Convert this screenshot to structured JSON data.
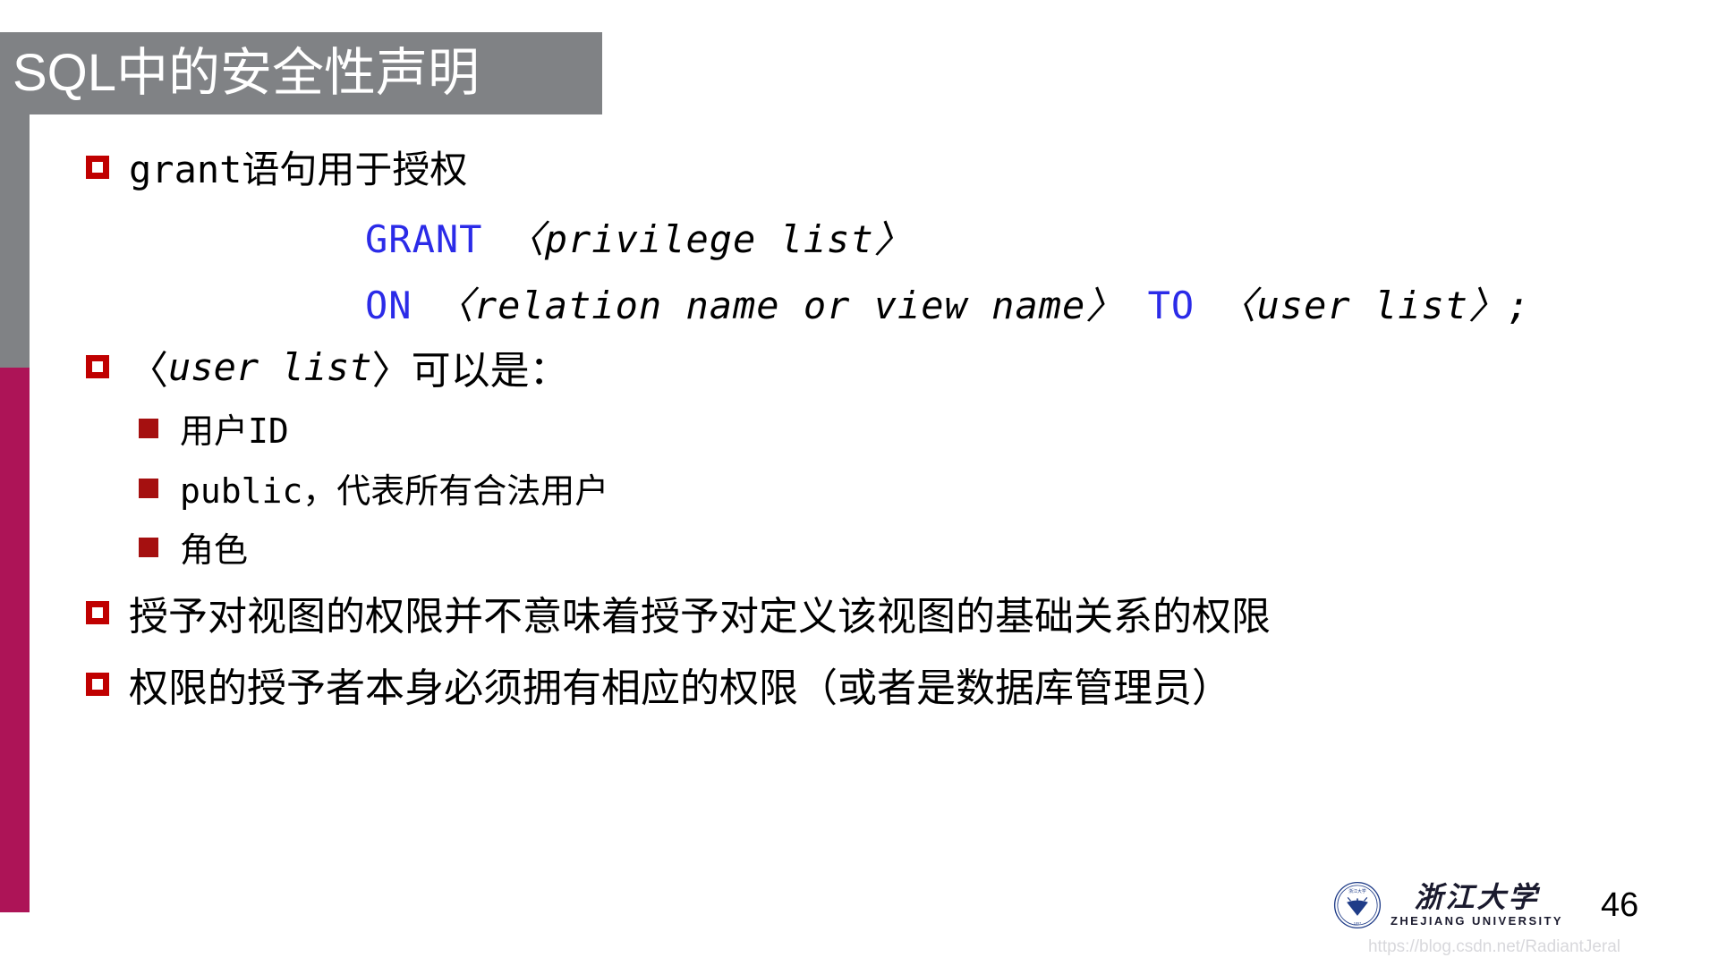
{
  "slide": {
    "title": "SQL中的安全性声明",
    "colors": {
      "banner": "#808285",
      "left_strip_top": "#808285",
      "left_strip_bottom": "#AD1457",
      "bullet_level1": "#C00000",
      "bullet_level2": "#A51010",
      "keyword": "#2B2BE8",
      "text": "#000000",
      "title_text": "#FFFFFF"
    },
    "bullets": [
      {
        "level": 1,
        "marker": "hollow-red-square",
        "text": "grant语句用于授权"
      },
      {
        "level": 1,
        "marker": "hollow-red-square",
        "text": "〈 user list 〉 可以是："
      },
      {
        "level": 2,
        "marker": "solid-red-square",
        "text": "用户ID"
      },
      {
        "level": 2,
        "marker": "solid-red-square",
        "text": "public，代表所有合法用户"
      },
      {
        "level": 2,
        "marker": "solid-red-square",
        "text": "角色"
      },
      {
        "level": 1,
        "marker": "hollow-red-square",
        "text": "授予对视图的权限并不意味着授予对定义该视图的基础关系的权限"
      },
      {
        "level": 1,
        "marker": "hollow-red-square",
        "text": "权限的授予者本身必须拥有相应的权限（或者是数据库管理员）"
      }
    ],
    "code": {
      "line1": {
        "keyword": "GRANT",
        "placeholder": "〈privilege list〉"
      },
      "line2": {
        "keyword1": "ON",
        "placeholder1": "〈relation name or view name〉",
        "keyword2": "TO",
        "placeholder2": "〈user list〉",
        "terminator": ";"
      }
    },
    "bullet2_parts": {
      "open": "〈",
      "italic": " user list ",
      "close": "〉",
      "tail": " 可以是："
    },
    "footer": {
      "logo_cn": "浙江大学",
      "logo_en": "ZHEJIANG UNIVERSITY",
      "page_number": "46",
      "watermark": "https://blog.csdn.net/RadiantJeral"
    }
  }
}
